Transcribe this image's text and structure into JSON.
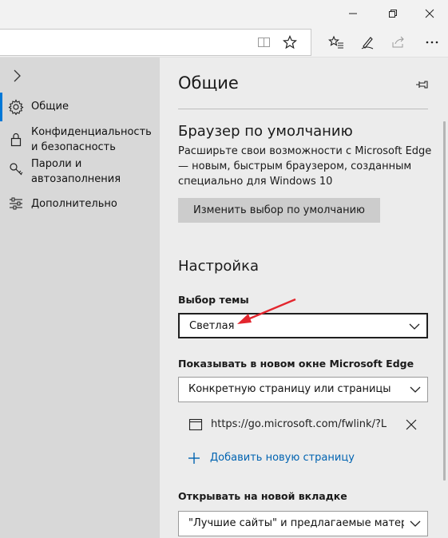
{
  "window": {
    "controls": [
      "minimize-icon",
      "maximize-icon",
      "close-icon"
    ]
  },
  "toolbar": {
    "icons": [
      "reading-view-icon",
      "favorites-star-icon",
      "favorites-hub-icon",
      "pen-icon",
      "share-icon",
      "more-icon"
    ]
  },
  "sidebar": {
    "items": [
      {
        "label": "Общие",
        "icon": "gear-icon",
        "selected": true
      },
      {
        "label": "Конфиденциальность и безопасность",
        "icon": "lock-icon"
      },
      {
        "label": "Пароли и автозаполнения",
        "icon": "key-icon"
      },
      {
        "label": "Дополнительно",
        "icon": "sliders-icon"
      }
    ]
  },
  "panel": {
    "title": "Общие",
    "default_browser": {
      "heading": "Браузер по умолчанию",
      "description": "Расширьте свои возможности с Microsoft Edge — новым, быстрым браузером, созданным специально для Windows 10",
      "button": "Изменить выбор по умолчанию"
    },
    "customize": {
      "heading": "Настройка",
      "theme_label": "Выбор темы",
      "theme_value": "Светлая",
      "open_label": "Показывать в новом окне Microsoft Edge",
      "open_value": "Конкретную страницу или страницы",
      "page_url": "https://go.microsoft.com/fwlink/?Link",
      "add_page": "Добавить новую страницу",
      "newtab_label": "Открывать на новой вкладке",
      "newtab_value": "\"Лучшие сайты\" и предлагаемые материа"
    }
  },
  "colors": {
    "accent": "#0078d7",
    "link": "#0063b1",
    "annotation_arrow": "#e3262e"
  }
}
